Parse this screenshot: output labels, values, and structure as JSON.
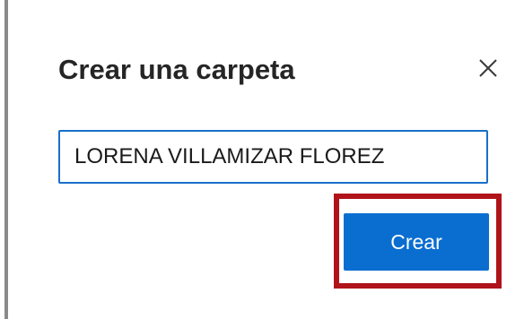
{
  "dialog": {
    "title": "Crear una carpeta",
    "close_icon": "close-icon",
    "folder_name_value": "LORENA VILLAMIZAR FLOREZ",
    "create_button_label": "Crear"
  },
  "colors": {
    "accent": "#0a6ed1",
    "input_border": "#1a6fc9",
    "highlight": "#b0141a",
    "title_text": "#252525"
  }
}
